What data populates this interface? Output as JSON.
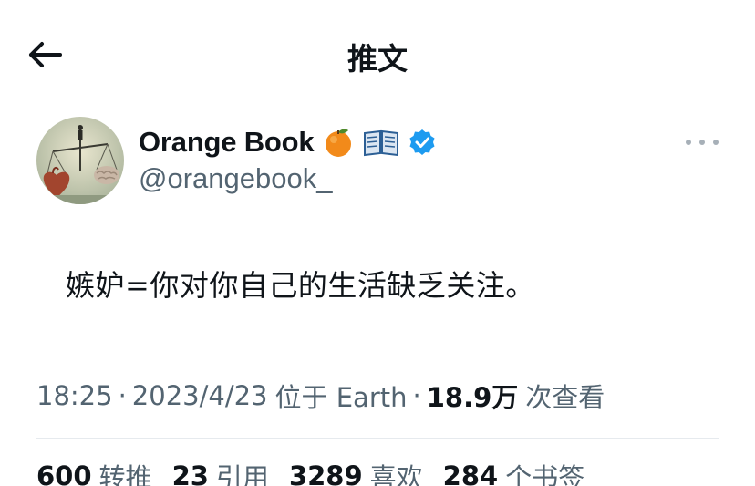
{
  "header": {
    "title": "推文",
    "back_icon": "arrow-left-icon"
  },
  "author": {
    "display_name": "Orange Book",
    "handle": "@orangebook_",
    "emojis": [
      "orange-emoji",
      "open-book-emoji"
    ],
    "verified_badge": "verified-badge-icon",
    "verified_color": "#1d9bf0",
    "more_icon": "more-horizontal-icon"
  },
  "tweet": {
    "text": "嫉妒=你对你自己的生活缺乏关注。"
  },
  "meta": {
    "time": "18:25",
    "separator": "·",
    "date": "2023/4/23",
    "location": "位于 Earth",
    "views_count": "18.9万",
    "views_label": "次查看"
  },
  "stats": [
    {
      "count": "600",
      "label": "转推"
    },
    {
      "count": "23",
      "label": "引用"
    },
    {
      "count": "3289",
      "label": "喜欢"
    },
    {
      "count": "284",
      "label": "个书签"
    }
  ]
}
